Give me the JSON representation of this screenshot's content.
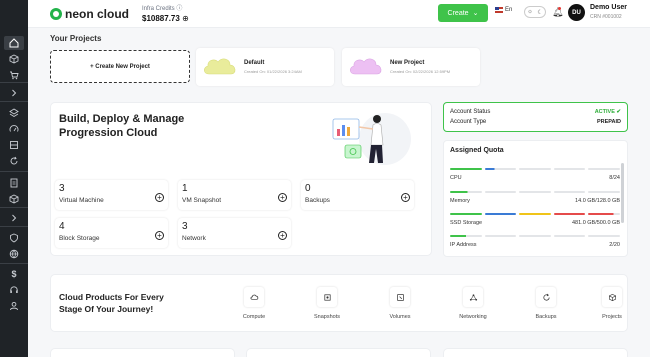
{
  "brand": {
    "name": "neon cloud"
  },
  "header": {
    "credits_label": "Infra Credits",
    "credits_value": "$10887.73",
    "create_label": "Create",
    "language": "En",
    "user_initials": "DU",
    "user_name": "Demo User",
    "user_crn": "CRN #001002"
  },
  "sidebar": {
    "items": [
      {
        "icon": "home-icon",
        "active": true
      },
      {
        "icon": "cube-icon"
      },
      {
        "icon": "cart-icon"
      },
      {
        "icon": "chevron-right-icon"
      },
      {
        "icon": "layers-icon"
      },
      {
        "icon": "gauge-icon"
      },
      {
        "icon": "storage-icon"
      },
      {
        "icon": "refresh-icon"
      },
      {
        "icon": "network-icon"
      },
      {
        "icon": "document-icon"
      },
      {
        "icon": "box-icon"
      },
      {
        "icon": "chevron-right-icon"
      },
      {
        "icon": "security-icon"
      },
      {
        "icon": "globe-icon"
      },
      {
        "icon": "dollar-icon"
      },
      {
        "icon": "headset-icon"
      },
      {
        "icon": "user-icon"
      }
    ]
  },
  "projects": {
    "title": "Your Projects",
    "create_label": "+ Create New Project",
    "items": [
      {
        "name": "Default",
        "created": "Created On: 01/22/2026 3:24AM",
        "color": "#e9ec9b"
      },
      {
        "name": "New Project",
        "created": "Created On: 02/22/2026 12:59PM",
        "color": "#e9b8f0"
      }
    ]
  },
  "hero": {
    "title": "Build, Deploy & Manage Progression Cloud",
    "stats": [
      {
        "count": "3",
        "label": "Virtual Machine"
      },
      {
        "count": "1",
        "label": "VM Snapshot"
      },
      {
        "count": "0",
        "label": "Backups"
      },
      {
        "count": "4",
        "label": "Block Storage"
      },
      {
        "count": "3",
        "label": "Network"
      }
    ]
  },
  "account": {
    "status_label": "Account Status",
    "status_value": "ACTIVE",
    "type_label": "Account Type",
    "type_value": "PREPAID",
    "status_color": "#2fae3a"
  },
  "quota": {
    "title": "Assigned Quota",
    "items": [
      {
        "label": "CPU",
        "value": "8/24",
        "fraction": 0.33
      },
      {
        "label": "Memory",
        "value": "14.0 GB/128.0 GB",
        "fraction": 0.11
      },
      {
        "label": "SSD Storage",
        "value": "481.0 GB/500.0 GB",
        "fraction": 0.96
      },
      {
        "label": "IP Address",
        "value": "2/20",
        "fraction": 0.1
      }
    ]
  },
  "products": {
    "title": "Cloud Products For Every Stage Of Your Journey!",
    "items": [
      {
        "label": "Compute",
        "icon": "compute-icon"
      },
      {
        "label": "Snapshots",
        "icon": "snapshot-icon"
      },
      {
        "label": "Volumes",
        "icon": "volume-icon"
      },
      {
        "label": "Networking",
        "icon": "networking-icon"
      },
      {
        "label": "Backups",
        "icon": "backup-icon"
      },
      {
        "label": "Projects",
        "icon": "projects-icon"
      }
    ]
  },
  "colors": {
    "accent": "#3fc34a",
    "sidebar": "#1f2327",
    "progress_green": "#3fc34a",
    "progress_blue": "#3a7bd5",
    "progress_yellow": "#f0c419",
    "progress_red": "#e54b4b"
  }
}
